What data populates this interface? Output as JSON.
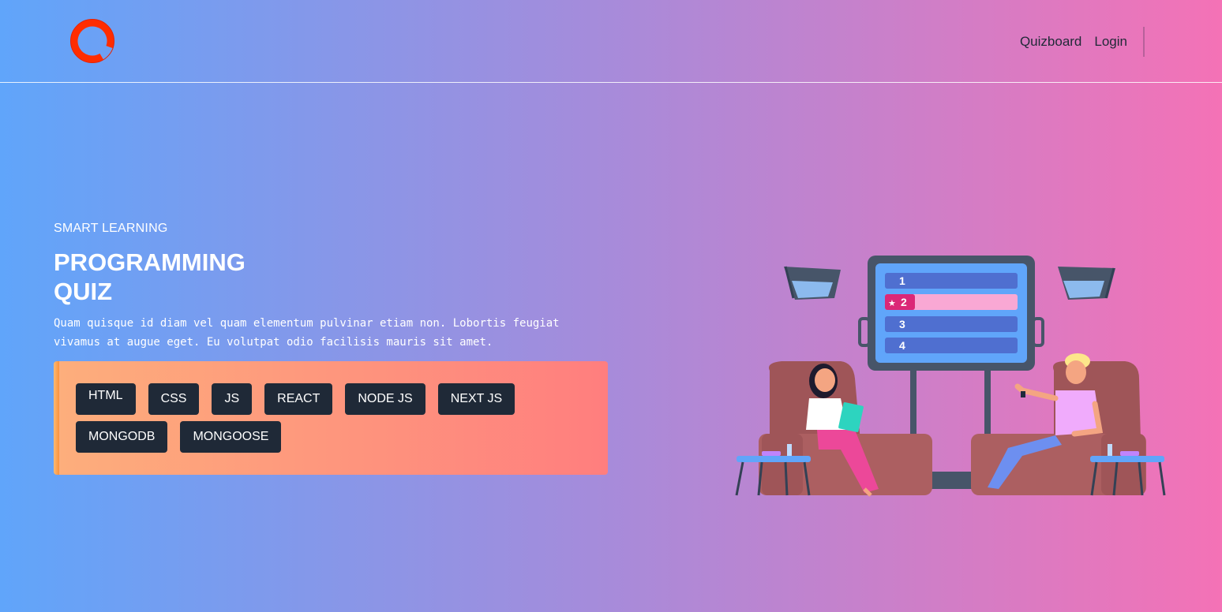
{
  "header": {
    "logo_icon": "ring-logo",
    "nav": [
      {
        "label": "Quizboard"
      },
      {
        "label": "Login"
      }
    ]
  },
  "hero": {
    "eyebrow": "SMART LEARNING",
    "title_line1": "PROGRAMMING",
    "title_line2": "QUIZ",
    "description": "Quam quisque id diam vel quam elementum pulvinar etiam non. Lobortis feugiat vivamus at augue eget. Eu volutpat odio facilisis mauris sit amet.",
    "tags": [
      {
        "label": "HTML"
      },
      {
        "label": "CSS"
      },
      {
        "label": "JS"
      },
      {
        "label": "REACT"
      },
      {
        "label": "NODE JS"
      },
      {
        "label": "NEXT JS"
      },
      {
        "label": "MONGODB"
      },
      {
        "label": "MONGOOSE"
      }
    ]
  },
  "illustration": {
    "scoreboard": [
      "1",
      "2",
      "3",
      "4"
    ],
    "highlighted_row": "2"
  },
  "colors": {
    "gradient_start": "#60a5fa",
    "gradient_end": "#f472b6",
    "tag_bg": "#1f2937",
    "logo": "#ff2d00"
  }
}
